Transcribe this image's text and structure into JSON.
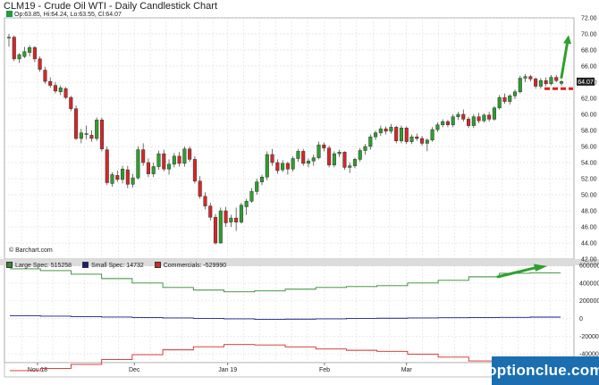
{
  "header": {
    "title": "CLM19 - Crude Oil WTI - Daily Candlestick Chart",
    "ohlc": "Op:63.85, Hi:64.24, Lo:63.55, Cl:64.07"
  },
  "credit": "© Barchart.com",
  "watermark": "optionclue.com",
  "colors": {
    "up": "#2ca02c",
    "down": "#d62728",
    "large": "#2e8b2e",
    "small": "#1a1a8c",
    "commercials": "#d62728",
    "annotation_arrow": "#2ea02e",
    "annotation_dash": "#e02020"
  },
  "chart_data": [
    {
      "type": "candlestick",
      "title": "CLM19 - Crude Oil WTI - Daily Candlestick Chart",
      "last_price_label": "64.07",
      "ylim": [
        42,
        72
      ],
      "y_ticks": [
        "42.00",
        "44.00",
        "46.00",
        "48.00",
        "50.00",
        "52.00",
        "54.00",
        "56.00",
        "58.00",
        "60.00",
        "62.00",
        "64.00",
        "66.00",
        "68.00",
        "70.00",
        "72.00"
      ],
      "x_ticks": [
        "Nov 18",
        "Dec",
        "Jan 19",
        "Feb",
        "Mar"
      ],
      "annotations": [
        "up-arrow",
        "support-dash"
      ],
      "candles": [
        {
          "o": 69.5,
          "h": 70.0,
          "l": 68.4,
          "c": 69.6
        },
        {
          "o": 69.6,
          "h": 69.8,
          "l": 66.6,
          "c": 66.9
        },
        {
          "o": 66.9,
          "h": 67.6,
          "l": 66.4,
          "c": 67.4
        },
        {
          "o": 67.2,
          "h": 68.4,
          "l": 67.0,
          "c": 67.8
        },
        {
          "o": 67.7,
          "h": 68.6,
          "l": 67.2,
          "c": 68.3
        },
        {
          "o": 68.3,
          "h": 68.5,
          "l": 66.5,
          "c": 66.9
        },
        {
          "o": 66.9,
          "h": 67.2,
          "l": 65.3,
          "c": 65.6
        },
        {
          "o": 65.5,
          "h": 65.9,
          "l": 63.8,
          "c": 64.1
        },
        {
          "o": 64.1,
          "h": 64.6,
          "l": 63.3,
          "c": 63.6
        },
        {
          "o": 63.6,
          "h": 64.0,
          "l": 62.6,
          "c": 62.9
        },
        {
          "o": 62.8,
          "h": 63.6,
          "l": 62.4,
          "c": 63.3
        },
        {
          "o": 63.2,
          "h": 63.4,
          "l": 61.9,
          "c": 62.1
        },
        {
          "o": 62.1,
          "h": 62.3,
          "l": 60.4,
          "c": 60.7
        },
        {
          "o": 60.7,
          "h": 61.1,
          "l": 56.8,
          "c": 57.0
        },
        {
          "o": 57.0,
          "h": 58.2,
          "l": 56.4,
          "c": 57.7
        },
        {
          "o": 57.6,
          "h": 58.6,
          "l": 56.9,
          "c": 57.5
        },
        {
          "o": 57.4,
          "h": 58.0,
          "l": 56.6,
          "c": 57.0
        },
        {
          "o": 57.0,
          "h": 59.6,
          "l": 56.7,
          "c": 59.3
        },
        {
          "o": 59.3,
          "h": 59.6,
          "l": 55.4,
          "c": 55.7
        },
        {
          "o": 55.6,
          "h": 56.0,
          "l": 51.2,
          "c": 51.5
        },
        {
          "o": 51.4,
          "h": 52.8,
          "l": 51.0,
          "c": 52.5
        },
        {
          "o": 52.4,
          "h": 53.0,
          "l": 51.6,
          "c": 51.9
        },
        {
          "o": 51.9,
          "h": 53.6,
          "l": 51.4,
          "c": 53.2
        },
        {
          "o": 53.1,
          "h": 53.6,
          "l": 50.8,
          "c": 51.3
        },
        {
          "o": 51.3,
          "h": 52.6,
          "l": 50.9,
          "c": 52.1
        },
        {
          "o": 52.1,
          "h": 56.0,
          "l": 51.9,
          "c": 55.6
        },
        {
          "o": 55.6,
          "h": 56.4,
          "l": 53.6,
          "c": 54.0
        },
        {
          "o": 54.0,
          "h": 54.5,
          "l": 52.2,
          "c": 52.6
        },
        {
          "o": 52.6,
          "h": 54.0,
          "l": 52.2,
          "c": 53.5
        },
        {
          "o": 53.5,
          "h": 55.5,
          "l": 53.1,
          "c": 55.1
        },
        {
          "o": 55.1,
          "h": 55.6,
          "l": 52.9,
          "c": 53.2
        },
        {
          "o": 53.2,
          "h": 54.4,
          "l": 52.5,
          "c": 53.8
        },
        {
          "o": 53.8,
          "h": 55.2,
          "l": 53.4,
          "c": 54.8
        },
        {
          "o": 54.8,
          "h": 55.3,
          "l": 53.5,
          "c": 53.9
        },
        {
          "o": 53.9,
          "h": 56.0,
          "l": 53.5,
          "c": 55.7
        },
        {
          "o": 55.7,
          "h": 56.0,
          "l": 54.1,
          "c": 54.4
        },
        {
          "o": 54.4,
          "h": 54.8,
          "l": 51.4,
          "c": 51.7
        },
        {
          "o": 51.7,
          "h": 52.3,
          "l": 49.5,
          "c": 49.8
        },
        {
          "o": 49.8,
          "h": 50.3,
          "l": 48.2,
          "c": 48.6
        },
        {
          "o": 48.6,
          "h": 49.0,
          "l": 46.8,
          "c": 47.2
        },
        {
          "o": 47.2,
          "h": 47.6,
          "l": 43.8,
          "c": 44.0
        },
        {
          "o": 44.0,
          "h": 48.4,
          "l": 43.9,
          "c": 48.0
        },
        {
          "o": 48.0,
          "h": 48.5,
          "l": 46.0,
          "c": 46.5
        },
        {
          "o": 46.6,
          "h": 47.5,
          "l": 46.0,
          "c": 47.1
        },
        {
          "o": 47.1,
          "h": 48.4,
          "l": 45.5,
          "c": 46.6
        },
        {
          "o": 46.6,
          "h": 49.0,
          "l": 46.4,
          "c": 48.7
        },
        {
          "o": 48.5,
          "h": 49.5,
          "l": 47.5,
          "c": 49.2
        },
        {
          "o": 49.2,
          "h": 50.8,
          "l": 49.0,
          "c": 50.4
        },
        {
          "o": 50.4,
          "h": 52.0,
          "l": 50.0,
          "c": 51.6
        },
        {
          "o": 51.6,
          "h": 52.5,
          "l": 51.2,
          "c": 52.2
        },
        {
          "o": 52.2,
          "h": 55.4,
          "l": 51.8,
          "c": 55.0
        },
        {
          "o": 55.0,
          "h": 55.7,
          "l": 53.6,
          "c": 54.0
        },
        {
          "o": 54.0,
          "h": 54.4,
          "l": 52.6,
          "c": 53.0
        },
        {
          "o": 53.1,
          "h": 54.3,
          "l": 52.8,
          "c": 53.9
        },
        {
          "o": 53.9,
          "h": 54.1,
          "l": 52.5,
          "c": 53.2
        },
        {
          "o": 53.2,
          "h": 54.8,
          "l": 52.9,
          "c": 54.5
        },
        {
          "o": 54.5,
          "h": 55.7,
          "l": 54.1,
          "c": 55.4
        },
        {
          "o": 55.4,
          "h": 55.7,
          "l": 53.6,
          "c": 53.9
        },
        {
          "o": 53.9,
          "h": 54.5,
          "l": 53.4,
          "c": 54.2
        },
        {
          "o": 54.2,
          "h": 55.0,
          "l": 53.6,
          "c": 54.6
        },
        {
          "o": 54.6,
          "h": 56.6,
          "l": 54.4,
          "c": 56.2
        },
        {
          "o": 56.2,
          "h": 56.5,
          "l": 55.4,
          "c": 55.8
        },
        {
          "o": 55.8,
          "h": 56.1,
          "l": 53.4,
          "c": 53.7
        },
        {
          "o": 53.7,
          "h": 55.4,
          "l": 53.4,
          "c": 55.1
        },
        {
          "o": 55.1,
          "h": 55.6,
          "l": 54.7,
          "c": 55.3
        },
        {
          "o": 55.3,
          "h": 55.4,
          "l": 53.1,
          "c": 53.4
        },
        {
          "o": 53.4,
          "h": 54.0,
          "l": 52.7,
          "c": 53.6
        },
        {
          "o": 53.6,
          "h": 54.6,
          "l": 53.3,
          "c": 54.4
        },
        {
          "o": 54.4,
          "h": 55.8,
          "l": 54.1,
          "c": 55.5
        },
        {
          "o": 55.5,
          "h": 56.3,
          "l": 55.0,
          "c": 56.0
        },
        {
          "o": 56.0,
          "h": 57.5,
          "l": 55.6,
          "c": 57.2
        },
        {
          "o": 57.2,
          "h": 58.0,
          "l": 56.8,
          "c": 57.7
        },
        {
          "o": 57.7,
          "h": 58.6,
          "l": 57.3,
          "c": 58.2
        },
        {
          "o": 58.2,
          "h": 58.5,
          "l": 57.5,
          "c": 57.9
        },
        {
          "o": 57.9,
          "h": 58.8,
          "l": 57.6,
          "c": 58.4
        },
        {
          "o": 58.4,
          "h": 58.6,
          "l": 56.4,
          "c": 56.7
        },
        {
          "o": 56.7,
          "h": 58.6,
          "l": 56.4,
          "c": 58.3
        },
        {
          "o": 58.3,
          "h": 58.5,
          "l": 56.3,
          "c": 56.6
        },
        {
          "o": 56.6,
          "h": 57.5,
          "l": 56.3,
          "c": 57.2
        },
        {
          "o": 57.2,
          "h": 57.6,
          "l": 56.7,
          "c": 57.0
        },
        {
          "o": 57.0,
          "h": 57.3,
          "l": 56.1,
          "c": 56.4
        },
        {
          "o": 56.4,
          "h": 57.0,
          "l": 55.4,
          "c": 56.8
        },
        {
          "o": 56.8,
          "h": 58.4,
          "l": 56.6,
          "c": 58.1
        },
        {
          "o": 58.1,
          "h": 59.0,
          "l": 57.8,
          "c": 58.7
        },
        {
          "o": 58.7,
          "h": 59.4,
          "l": 58.4,
          "c": 59.1
        },
        {
          "o": 59.1,
          "h": 59.3,
          "l": 58.4,
          "c": 58.7
        },
        {
          "o": 58.7,
          "h": 60.0,
          "l": 58.4,
          "c": 59.7
        },
        {
          "o": 59.7,
          "h": 60.3,
          "l": 59.3,
          "c": 60.0
        },
        {
          "o": 60.0,
          "h": 60.6,
          "l": 59.1,
          "c": 59.4
        },
        {
          "o": 59.4,
          "h": 59.7,
          "l": 58.3,
          "c": 58.6
        },
        {
          "o": 58.6,
          "h": 60.0,
          "l": 58.3,
          "c": 59.7
        },
        {
          "o": 59.7,
          "h": 60.2,
          "l": 58.9,
          "c": 59.2
        },
        {
          "o": 59.2,
          "h": 60.1,
          "l": 59.0,
          "c": 59.9
        },
        {
          "o": 59.9,
          "h": 60.3,
          "l": 59.1,
          "c": 59.4
        },
        {
          "o": 59.4,
          "h": 61.0,
          "l": 59.2,
          "c": 60.8
        },
        {
          "o": 60.8,
          "h": 62.4,
          "l": 60.6,
          "c": 62.1
        },
        {
          "o": 62.1,
          "h": 62.6,
          "l": 61.3,
          "c": 61.6
        },
        {
          "o": 61.6,
          "h": 62.5,
          "l": 61.2,
          "c": 62.3
        },
        {
          "o": 62.3,
          "h": 63.1,
          "l": 61.9,
          "c": 62.8
        },
        {
          "o": 62.8,
          "h": 64.8,
          "l": 62.6,
          "c": 64.5
        },
        {
          "o": 64.5,
          "h": 65.0,
          "l": 64.0,
          "c": 64.7
        },
        {
          "o": 64.7,
          "h": 64.9,
          "l": 64.1,
          "c": 64.4
        },
        {
          "o": 64.4,
          "h": 64.6,
          "l": 63.2,
          "c": 63.5
        },
        {
          "o": 63.5,
          "h": 64.5,
          "l": 63.2,
          "c": 64.2
        },
        {
          "o": 64.2,
          "h": 64.6,
          "l": 63.5,
          "c": 63.8
        },
        {
          "o": 63.8,
          "h": 64.9,
          "l": 63.6,
          "c": 64.6
        },
        {
          "o": 64.6,
          "h": 64.9,
          "l": 64.0,
          "c": 64.2
        },
        {
          "o": 63.85,
          "h": 64.24,
          "l": 63.55,
          "c": 64.07
        }
      ]
    },
    {
      "type": "line",
      "title": "",
      "ylim": [
        -500000,
        600000
      ],
      "y_ticks": [
        "600000",
        "400000",
        "200000",
        "0",
        "-200000",
        "-400000"
      ],
      "x_ticks": [
        "Nov 18",
        "Dec",
        "Jan 19",
        "Feb",
        "Mar"
      ],
      "step": true,
      "series": [
        {
          "name": "Large Spec: 515258",
          "values": [
            560000,
            540000,
            500000,
            450000,
            400000,
            350000,
            320000,
            300000,
            310000,
            330000,
            350000,
            360000,
            370000,
            400000,
            430000,
            470000,
            510000,
            515258
          ]
        },
        {
          "name": "Small Spec: 14732",
          "values": [
            30000,
            25000,
            20000,
            15000,
            10000,
            5000,
            0,
            -5000,
            -10000,
            -8000,
            -5000,
            0,
            2000,
            5000,
            8000,
            10000,
            12000,
            14732
          ]
        },
        {
          "name": "Commercials: -529990",
          "values": [
            -590000,
            -565000,
            -520000,
            -465000,
            -410000,
            -355000,
            -320000,
            -295000,
            -300000,
            -322000,
            -345000,
            -360000,
            -372000,
            -405000,
            -438000,
            -480000,
            -522000,
            -529990
          ]
        }
      ]
    }
  ]
}
